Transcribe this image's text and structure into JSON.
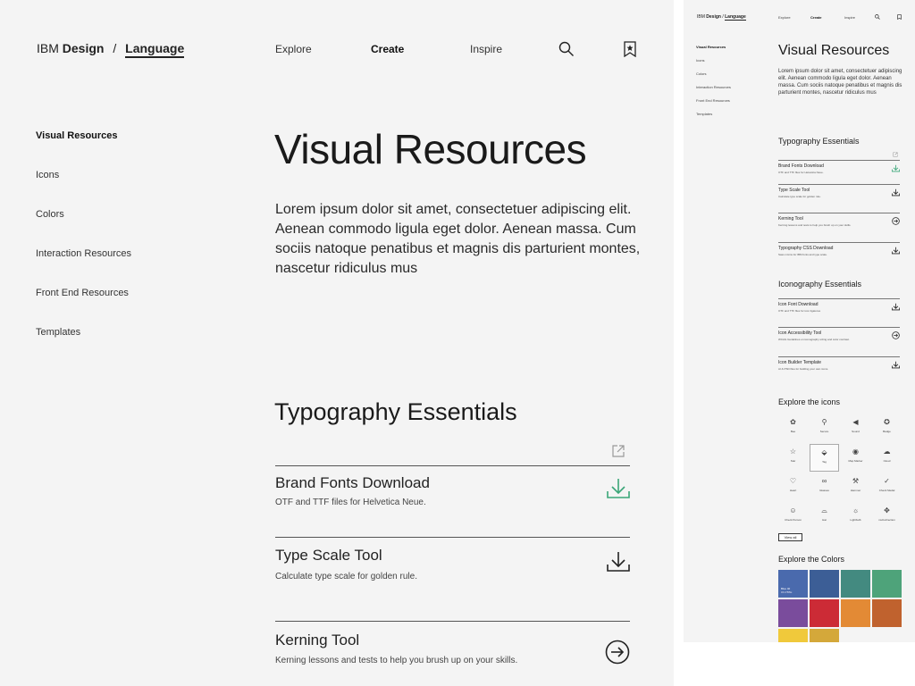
{
  "brand": {
    "prefix": "IBM",
    "design": "Design",
    "separator": "/",
    "language": "Language"
  },
  "nav": {
    "explore": "Explore",
    "create": "Create",
    "inspire": "Inspire"
  },
  "sidebar": {
    "items": [
      {
        "label": "Visual Resources",
        "active": true
      },
      {
        "label": "Icons"
      },
      {
        "label": "Colors"
      },
      {
        "label": "Interaction Resources"
      },
      {
        "label": "Front End Resources"
      },
      {
        "label": "Templates"
      }
    ]
  },
  "main": {
    "title": "Visual Resources",
    "intro": "Lorem ipsum dolor sit amet, consectetuer adipiscing elit. Aenean commodo ligula eget dolor. Aenean massa. Cum sociis natoque penatibus et magnis dis parturient montes, nascetur ridiculus mus",
    "typography": {
      "title": "Typography Essentials",
      "items": [
        {
          "title": "Brand Fonts Download",
          "desc": "OTF and TTF files  for Helvetica Neue.",
          "icon": "download-icon",
          "icon_color": "#3aa678"
        },
        {
          "title": "Type Scale Tool",
          "desc": "Calculate type scale for golden rule.",
          "icon": "download-icon",
          "icon_color": "#222222"
        },
        {
          "title": "Kerning Tool",
          "desc": "Kerning lessons and tests to help you brush up on your skills.",
          "icon": "arrow-circle-icon",
          "icon_color": "#222222"
        },
        {
          "title": "Typography CSS Download",
          "desc": "Sass mixins for IBM fonts and type scale.",
          "icon": "download-icon",
          "icon_color": "#222222"
        }
      ]
    },
    "iconography": {
      "title": "Iconography Essentials",
      "items": [
        {
          "title": "Icon Font Download",
          "desc": "OTF and TTF files for icon ligatures",
          "icon": "download-icon"
        },
        {
          "title": "Icon Accessibility Tool",
          "desc": "WCAG Guidelines on iconography sizing and color contrast.",
          "icon": "arrow-circle-icon"
        },
        {
          "title": "Icon Builder Template",
          "desc": "AI & PSD files for building your own icons.",
          "icon": "download-icon"
        }
      ]
    },
    "explore_icons": {
      "title": "Explore the icons",
      "icons": [
        {
          "label": "Bee",
          "glyph": "✿"
        },
        {
          "label": "Secure",
          "glyph": "⚲"
        },
        {
          "label": "Sound",
          "glyph": "◀"
        },
        {
          "label": "Badge",
          "glyph": "✪"
        },
        {
          "label": "Star",
          "glyph": "☆"
        },
        {
          "label": "Tag",
          "glyph": "⬙",
          "selected": true
        },
        {
          "label": "Map Marker",
          "glyph": "◉"
        },
        {
          "label": "Cloud",
          "glyph": "☁"
        },
        {
          "label": "Heart",
          "glyph": "♡"
        },
        {
          "label": "Glasses",
          "glyph": "∞"
        },
        {
          "label": "Hammer",
          "glyph": "⚒"
        },
        {
          "label": "Check Medal",
          "glyph": "✓"
        },
        {
          "label": "Check Person",
          "glyph": "☺"
        },
        {
          "label": "Hat",
          "glyph": "⌓"
        },
        {
          "label": "Lightbulb",
          "glyph": "☼"
        },
        {
          "label": "multi-direction",
          "glyph": "✥"
        }
      ],
      "view_all": "View all"
    },
    "explore_colors": {
      "title": "Explore the Colors",
      "swatches": [
        {
          "color": "#4a6aad",
          "name": "Blue 40",
          "hex": "#4178BE"
        },
        {
          "color": "#3c5e96"
        },
        {
          "color": "#438a80"
        },
        {
          "color": "#4ea37a"
        },
        {
          "color": "#7a4c9c"
        },
        {
          "color": "#cc2b36"
        },
        {
          "color": "#e38a35"
        },
        {
          "color": "#c0622e"
        },
        {
          "color": "#f0c93b"
        },
        {
          "color": "#d4a83a"
        }
      ]
    }
  }
}
